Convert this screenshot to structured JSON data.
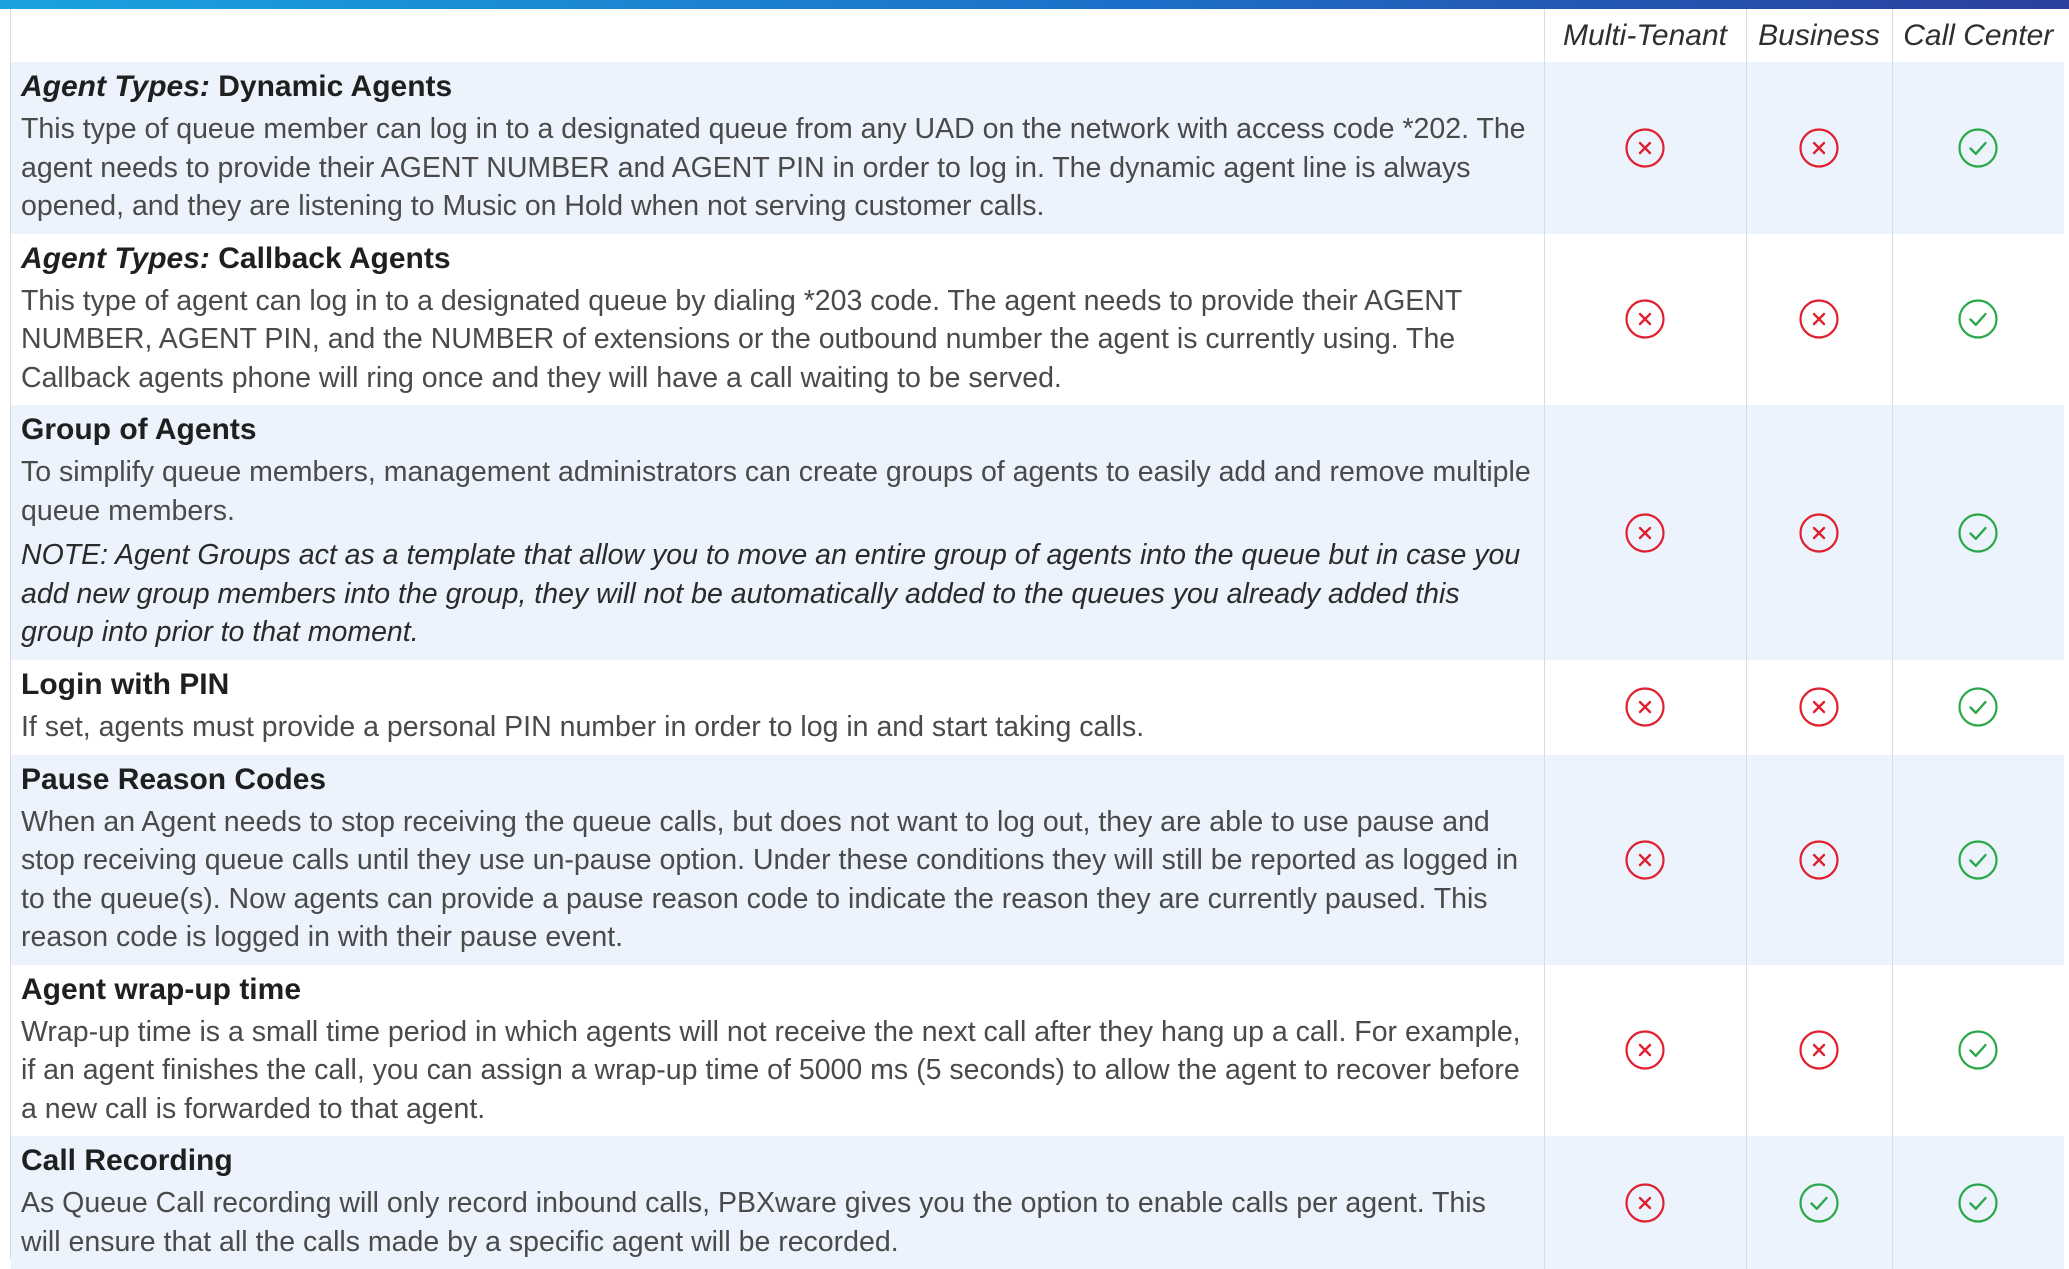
{
  "header": {
    "col_multi_tenant": "Multi-Tenant",
    "col_business": "Business",
    "col_call_center": "Call Center"
  },
  "colors": {
    "yes": "#2aa84a",
    "no": "#e0202e",
    "row_shade": "#ecf3fc",
    "accent_bar": "#1d6fc9"
  },
  "rows": [
    {
      "title_prefix": "Agent Types:",
      "title": "Dynamic Agents",
      "text": "This type of queue member can log in to a designated queue from any UAD on the network with access code *202. The agent needs to provide their AGENT NUMBER and AGENT PIN in order to log in. The dynamic agent line is always opened, and they are listening to Music on Hold when not serving customer calls.",
      "multi_tenant": "no",
      "business": "no",
      "call_center": "yes"
    },
    {
      "title_prefix": "Agent Types:",
      "title": "Callback Agents",
      "text": "This type of agent can log in to a designated queue by dialing *203 code. The agent needs to provide their AGENT NUMBER, AGENT PIN, and the NUMBER of extensions or the outbound number the agent is currently using. The Callback agents phone will ring once and they will have a call waiting to be served.",
      "multi_tenant": "no",
      "business": "no",
      "call_center": "yes"
    },
    {
      "title": "Group of Agents",
      "text": "To simplify queue members, management administrators can create groups of agents to easily add and remove multiple queue members.",
      "note": "NOTE: Agent Groups act as a template that allow you to move an entire group of agents into the queue but in case you add new group members into the group, they will not be automatically added to the queues you already added this group into prior to that moment.",
      "multi_tenant": "no",
      "business": "no",
      "call_center": "yes"
    },
    {
      "title": "Login with PIN",
      "text": "If set, agents must provide a personal PIN number in order to log in and start taking calls.",
      "multi_tenant": "no",
      "business": "no",
      "call_center": "yes"
    },
    {
      "title": "Pause Reason Codes",
      "text": "When an Agent needs to stop receiving the queue calls, but does not want to log out, they are able to use pause and stop receiving queue calls until they use un-pause option. Under these conditions they will still be reported as logged in to the queue(s). Now agents can provide a pause reason code to indicate the reason they are currently paused. This reason code is logged in with their pause event.",
      "multi_tenant": "no",
      "business": "no",
      "call_center": "yes"
    },
    {
      "title": "Agent wrap-up time",
      "text": "Wrap-up time is a small time period in which agents will not receive the next call after they hang up a call. For example, if an agent finishes the call, you can assign a wrap-up time of 5000 ms (5 seconds) to allow the agent to recover before a new call is forwarded to that agent.",
      "multi_tenant": "no",
      "business": "no",
      "call_center": "yes"
    },
    {
      "title": "Call Recording",
      "text": "As Queue Call recording will only record inbound calls, PBXware gives you the option to enable calls per agent. This will ensure that all the calls made by a specific agent will be recorded.",
      "multi_tenant": "no",
      "business": "yes",
      "call_center": "yes"
    }
  ]
}
